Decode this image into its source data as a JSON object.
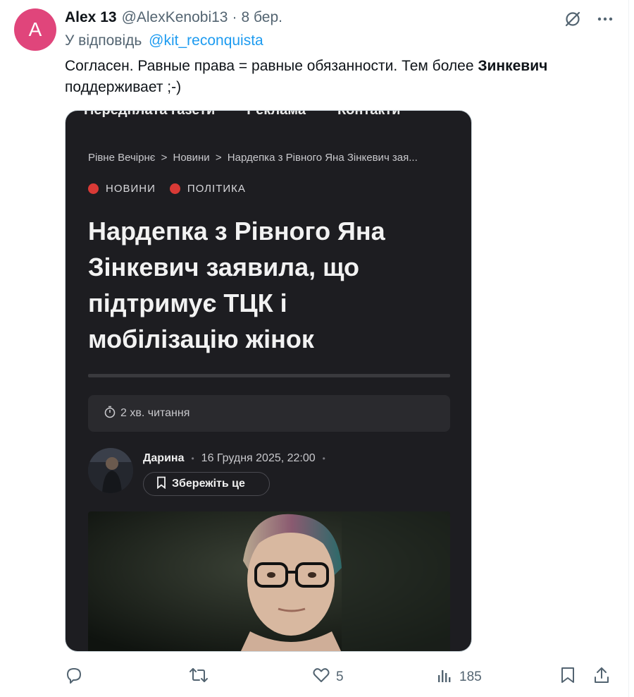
{
  "tweet": {
    "avatar_letter": "A",
    "avatar_color": "#e0457b",
    "display_name": "Alex 13",
    "handle": "@AlexKenobi13",
    "separator": "·",
    "date": "8 бер.",
    "replying_to_label": "У відповідь",
    "replying_to_handle": "@kit_reconquista",
    "text_part1": "Согласен. Равные права = равные обязанности. Тем более ",
    "text_bold": "Зинкевич",
    "text_part2": " поддерживает ;-)",
    "header_icons": [
      "grok-icon",
      "more-icon"
    ]
  },
  "embedded": {
    "nav_items": [
      "Передплата газети",
      "Реклама",
      "Контакти"
    ],
    "breadcrumb": [
      "Рівне Вечірнє",
      ">",
      "Новини",
      ">",
      "Нардепка з Рівного Яна Зінкевич зая..."
    ],
    "tags": [
      "НОВИНИ",
      "ПОЛІТИКА"
    ],
    "tag_color": "#d93a36",
    "headline": "Нардепка з Рівного Яна Зінкевич заявила, що підтримує ТЦК і мобілізацію жінок",
    "read_time": "2 хв. читання",
    "author": "Дарина",
    "dot": "•",
    "published": "16 Грудня 2025, 22:00",
    "save_label": "Збережіть це"
  },
  "actions": {
    "reply_count": "",
    "retweet_count": "",
    "like_count": "5",
    "views_count": "185"
  },
  "colors": {
    "link": "#1d9bf0",
    "secondary_text": "#536471",
    "media_bg": "#1d1d21"
  }
}
